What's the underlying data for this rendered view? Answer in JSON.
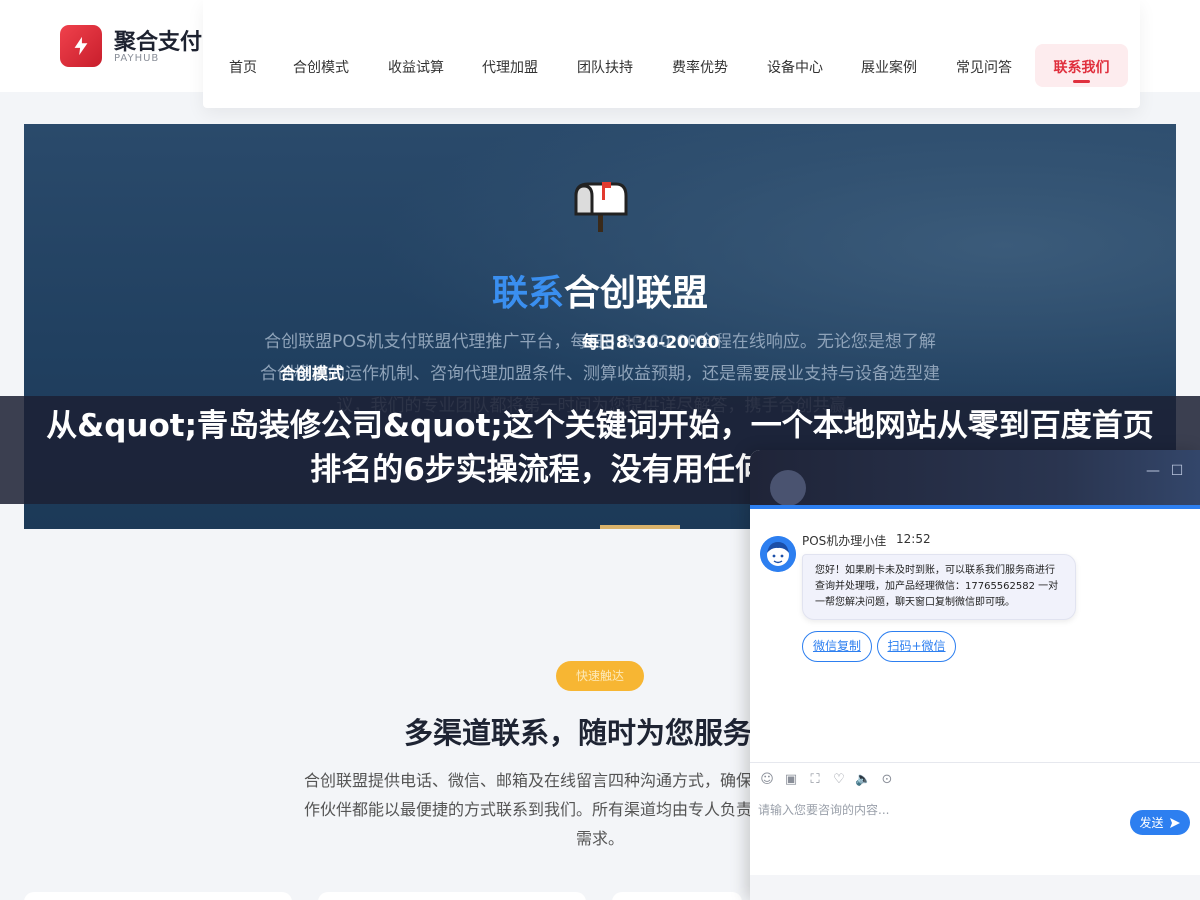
{
  "brand": {
    "name_cn": "聚合支付",
    "name_en": "PAYHUB",
    "accent": "#e0303e"
  },
  "nav": {
    "items": [
      "首页",
      "合创模式",
      "收益试算",
      "代理加盟",
      "团队扶持",
      "费率优势",
      "设备中心",
      "展业案例",
      "常见问答"
    ],
    "active_label": "联系我们"
  },
  "hero": {
    "title_part1": "联系",
    "title_part2": "合创联盟",
    "description": "合创联盟POS机支付联盟代理推广平台，每日8:30-20:00全程在线响应。无论您是想了解合创模式的运作机制、咨询代理加盟条件、测算收益预期，还是需要展业支持与设备选型建议，我们的专业团队都将第一时间为您提供详尽解答，携手合创共赢。",
    "hours": "每日8:30-20:00",
    "tag": "合创模式"
  },
  "overlay_title": "从&quot;青岛装修公司&quot;这个关键词开始，一个本地网站从零到百度首页排名的6步实操流程，没有用任何快排工具",
  "section": {
    "badge": "快速触达",
    "title": "多渠道联系，随时为您服务",
    "description": "合创联盟提供电话、微信、邮箱及在线留言四种沟通方式，确保每一位意向代理与合作伙伴都能以最便捷的方式联系到我们。所有渠道均由专人负责，第一时间响应您的需求。"
  },
  "chat": {
    "agent_name": "POS机办理小佳",
    "time": "12:52",
    "message": "您好！如果刷卡未及时到账，可以联系我们服务商进行查询并处理哦，加产品经理微信：17765562582 一对一帮您解决问题，聊天窗口复制微信即可哦。",
    "chip_copy": "微信复制",
    "chip_scan": "扫码+微信",
    "placeholder": "请输入您要咨询的内容...",
    "send_label": "发送",
    "minimize": "—",
    "maximize": "☐",
    "tool_icons": [
      "☺",
      "▣",
      "⛶",
      "♡",
      "🔈",
      "⊙"
    ]
  }
}
